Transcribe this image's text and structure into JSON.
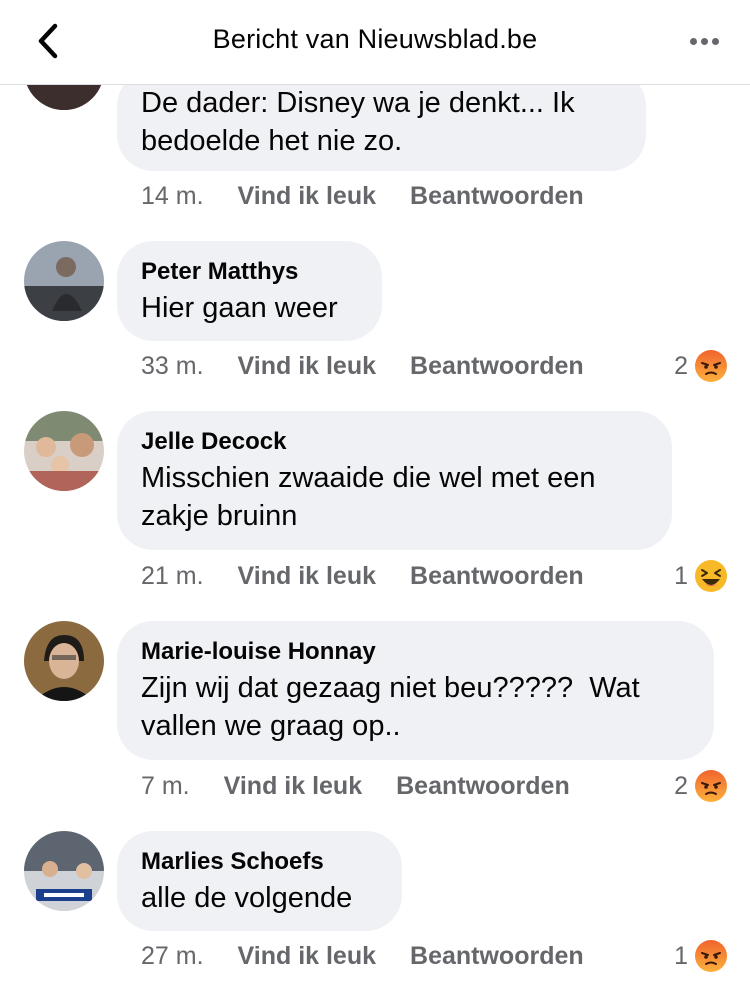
{
  "header": {
    "title": "Bericht van Nieuwsblad.be",
    "back_icon": "chevron-left-icon",
    "more_icon": "more-horizontal-icon"
  },
  "actions": {
    "like_label": "Vind ik leuk",
    "reply_label": "Beantwoorden"
  },
  "comments": [
    {
      "author": "",
      "text": "De dader: Disney wa je denkt... Ik\nbedoelde het nie zo.",
      "time": "14 m.",
      "reaction_count": "",
      "reaction": ""
    },
    {
      "author": "Peter Matthys",
      "text": "Hier gaan weer",
      "time": "33 m.",
      "reaction_count": "2",
      "reaction": "angry-emoji-icon"
    },
    {
      "author": "Jelle Decock",
      "text": "Misschien zwaaide die wel met een\nzakje bruinn",
      "time": "21 m.",
      "reaction_count": "1",
      "reaction": "laughing-emoji-icon"
    },
    {
      "author": "Marie-louise Honnay",
      "text": "Zijn wij dat gezaag niet beu?????  Wat\nvallen we graag op..",
      "time": "7 m.",
      "reaction_count": "2",
      "reaction": "angry-emoji-icon"
    },
    {
      "author": "Marlies Schoefs",
      "text": "alle de volgende",
      "time": "27 m.",
      "reaction_count": "1",
      "reaction": "angry-emoji-icon"
    }
  ],
  "colors": {
    "bubble": "#f0f1f5",
    "secondary_text": "#65676b",
    "angry_emoji": "#f0642e",
    "laughing_emoji": "#f7b928"
  }
}
